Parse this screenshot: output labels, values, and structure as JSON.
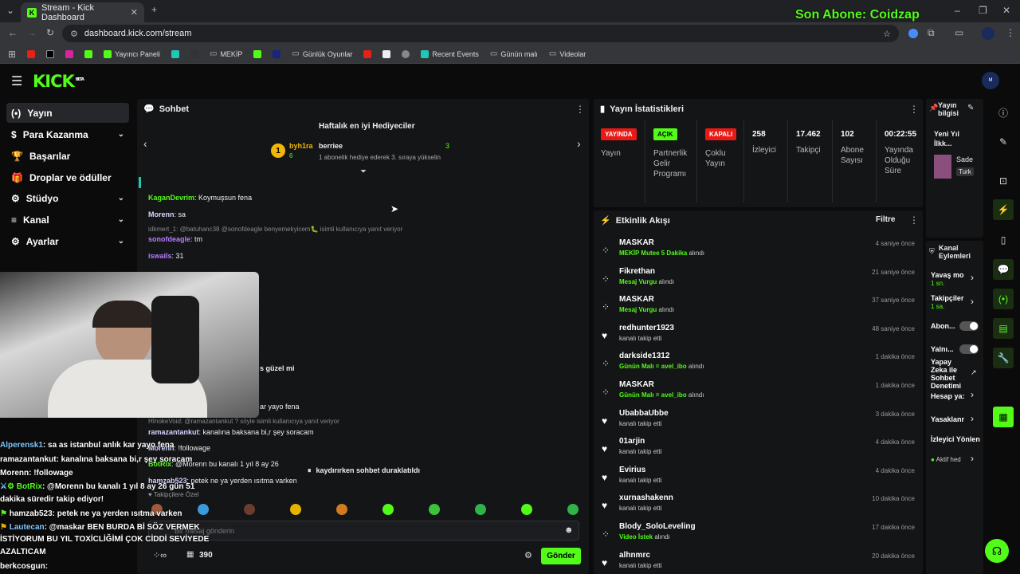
{
  "browser": {
    "tab_title": "Stream - Kick Dashboard",
    "url": "dashboard.kick.com/stream",
    "bookmarks": [
      "Yayıncı Paneli",
      "MEKİP",
      "Günlük Oyunlar",
      "Recent Events",
      "Günün malı",
      "Videolar"
    ]
  },
  "overlay": {
    "last_sub": "Son Abone: Coidzap"
  },
  "header": {
    "logo": "KICK",
    "beta": "BETA"
  },
  "sidebar": {
    "items": [
      {
        "label": "Yayın",
        "icon": "(•)"
      },
      {
        "label": "Para Kazanma",
        "icon": "$"
      },
      {
        "label": "Başarılar",
        "icon": "🏆"
      },
      {
        "label": "Droplar ve ödüller",
        "icon": "🎁"
      },
      {
        "label": "Stüdyo",
        "icon": "⚙"
      },
      {
        "label": "Kanal",
        "icon": "≡"
      },
      {
        "label": "Ayarlar",
        "icon": "⚙"
      }
    ]
  },
  "chat": {
    "title": "Sohbet",
    "gifters_title": "Haftalık en iyi Hediyeciler",
    "gifter1": {
      "name": "byh1ra",
      "count": "6",
      "rank": "1"
    },
    "gifter2": {
      "name": "berriee",
      "count": "3",
      "note": "1 abonelik hediye ederek 3. sıraya yükselin"
    },
    "messages": [
      {
        "user": "KaganDevrim",
        "text": ": Koymuşsun fena",
        "color": "#53fc18"
      },
      {
        "user": "Morenn",
        "text": ": sa",
        "color": "#d6d6ff"
      },
      {
        "user": "",
        "text": "idkmert_1: @batuhanc38 @sonofdeagle benyemekyicem🐛 isimli kullanıcıya yanıt veriyor",
        "color": "#888"
      },
      {
        "user": "sonofdeagle",
        "text": ": tm",
        "color": "#b77cff"
      },
      {
        "user": "iswails",
        "text": ": 31",
        "color": "#b77cff"
      },
      {
        "user": "",
        "text": "HInokeVoid: @ramazantankut ? söyle isimli kullanıcıya yanıt veriyor",
        "color": "#888"
      },
      {
        "user": "ramazantankut",
        "text": ": kanalına baksana bi,r şey soracam",
        "color": "#d6d6ff"
      },
      {
        "user": "Morenn",
        "text": ": !followage",
        "color": "#d6d6ff"
      },
      {
        "user": "BotRix",
        "text": ": @Morenn bu kanalı 1 yıl 8 ay 26",
        "color": "#53fc18"
      },
      {
        "user": "hamzab523",
        "text": ": petek ne ya yerden ısıtma varken",
        "color": "#d6d6ff"
      }
    ],
    "partial1": "s güzel mi",
    "partial2": "ar yayo fena",
    "paused": "kaydırırken sohbet duraklatıldı",
    "followers_only": "Takipçilere Özel",
    "input_placeholder": "Bir mesaj gönderin",
    "points": "390",
    "infinite": "∞",
    "send": "Gönder"
  },
  "stats": {
    "title": "Yayın İstatistikleri",
    "items": [
      {
        "badge": "YAYINDA",
        "label": "Yayın"
      },
      {
        "badge": "AÇIK",
        "label": "Partnerlik Gelir Programı"
      },
      {
        "badge": "KAPALI",
        "label": "Çoklu Yayın"
      },
      {
        "value": "258",
        "label": "İzleyici"
      },
      {
        "value": "17.462",
        "label": "Takipçi"
      },
      {
        "value": "102",
        "label": "Abone Sayısı"
      },
      {
        "value": "00:22:55",
        "label": "Yayında Olduğu Süre"
      }
    ]
  },
  "activity": {
    "title": "Etkinlik Akışı",
    "filter": "Filtre",
    "events": [
      {
        "name": "MASKAR",
        "hl": "MEKİP Mutee 5 Dakika",
        "tail": " alındı",
        "time": "4 saniye önce",
        "icon": "gift"
      },
      {
        "name": "Fikrethan",
        "hl": "Mesaj Vurgu",
        "tail": " alındı",
        "time": "21 saniye önce",
        "icon": "gift"
      },
      {
        "name": "MASKAR",
        "hl": "Mesaj Vurgu",
        "tail": " alındı",
        "time": "37 saniye önce",
        "icon": "gift"
      },
      {
        "name": "redhunter1923",
        "hl": "",
        "tail": "kanalı takip etti",
        "time": "48 saniye önce",
        "icon": "heart"
      },
      {
        "name": "darkside1312",
        "hl": "Günün Malı = avel_ibo",
        "tail": " alındı",
        "time": "1 dakika önce",
        "icon": "gift"
      },
      {
        "name": "MASKAR",
        "hl": "Günün Malı = avel_ibo",
        "tail": " alındı",
        "time": "1 dakika önce",
        "icon": "gift"
      },
      {
        "name": "UbabbaUbbe",
        "hl": "",
        "tail": "kanalı takip etti",
        "time": "3 dakika önce",
        "icon": "heart"
      },
      {
        "name": "01arjin",
        "hl": "",
        "tail": "kanalı takip etti",
        "time": "4 dakika önce",
        "icon": "heart"
      },
      {
        "name": "Evirius",
        "hl": "",
        "tail": "kanalı takip etti",
        "time": "4 dakika önce",
        "icon": "heart"
      },
      {
        "name": "xurnashakenn",
        "hl": "",
        "tail": "kanalı takip etti",
        "time": "10 dakika önce",
        "icon": "heart"
      },
      {
        "name": "Blody_SoloLeveling",
        "hl": "Video İstek",
        "tail": " alındı",
        "time": "17 dakika önce",
        "icon": "gift"
      },
      {
        "name": "alhnmrc",
        "hl": "",
        "tail": "kanalı takip etti",
        "time": "20 dakika önce",
        "icon": "heart"
      }
    ]
  },
  "stream_info": {
    "title": "Yayın bilgisi",
    "stream_title": "Yeni Yıl İlkk...",
    "category": "Sade",
    "tag": "Turk"
  },
  "channel_actions": {
    "title": "Kanal Eylemleri",
    "items": [
      {
        "label": "Yavaş mo",
        "sub": "1 sn."
      },
      {
        "label": "Takipçiler",
        "sub": "1 sa."
      },
      {
        "label": "Abon..."
      },
      {
        "label": "Yalnı..."
      },
      {
        "label": "Yapay Zeka ile Sohbet Denetimi"
      },
      {
        "label": "Hesap ya:"
      },
      {
        "label": "Yasaklanr"
      },
      {
        "label": "İzleyici Yönlen"
      },
      {
        "label": "Aktif hed"
      }
    ]
  },
  "stream_overlay_chat": [
    {
      "user": "Alperensk1",
      "text": ": sa as istanbul anlık kar yayo fena",
      "color": "#7ec8ff"
    },
    {
      "user": "ramazantankut",
      "text": ": kanalına baksana bi,r şey soracam",
      "color": "#fff"
    },
    {
      "user": "Morenn",
      "text": ": !followage",
      "color": "#fff"
    },
    {
      "user": "BotRix",
      "text": ": @Morenn bu kanalı 1 yıl 8 ay 26 gün 51",
      "color": "#53fc18"
    },
    {
      "user": "",
      "text": "dakika süredir takip ediyor!",
      "color": "#fff"
    },
    {
      "user": "hamzab523",
      "text": ": petek ne ya yerden ısıtma varken",
      "color": "#fff"
    },
    {
      "user": "Lautecan",
      "text": ": @maskar BEN BURDA Bİ SÖZ VERMEK",
      "color": "#7ec8ff"
    },
    {
      "user": "",
      "text": "İSTİYORUM BU YIL TOXİCLİĞİMİ ÇOK CİDDİ SEVİYEDE",
      "color": "#fff"
    },
    {
      "user": "",
      "text": "AZALTICAM",
      "color": "#fff"
    },
    {
      "user": "berkcosgun",
      "text": ":",
      "color": "#fff"
    }
  ],
  "colors": {
    "accent": "#53fc18",
    "live": "#e91916",
    "panel": "#141517"
  }
}
